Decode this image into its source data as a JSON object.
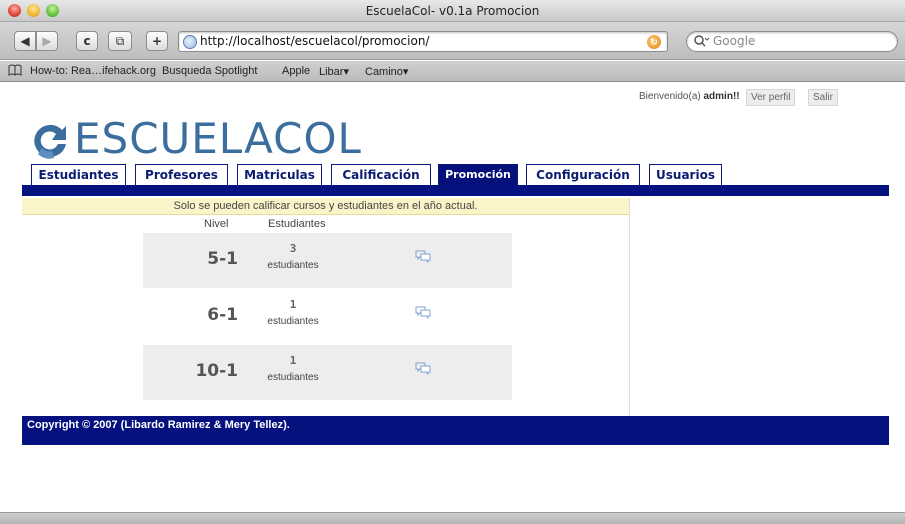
{
  "window": {
    "title": "EscuelaCol- v0.1a Promocion"
  },
  "toolbar": {
    "back": "◀",
    "forward": "▶",
    "reload": "c",
    "snapback": "⧉",
    "add": "+",
    "url": "http://localhost/escuelacol/promocion/",
    "search_placeholder": "Google"
  },
  "bookmarks": [
    "How-to: Rea…ifehack.org",
    "Busqueda Spotlight",
    "Apple",
    "Libar▾",
    "Camino▾"
  ],
  "header": {
    "welcome_prefix": "Bienvenido(a)",
    "username": "admin!!",
    "profile_button": "Ver perfil",
    "logout_button": "Salir",
    "logo_text": "ESCUELACOL"
  },
  "tabs": [
    {
      "label": "Estudiantes",
      "active": false
    },
    {
      "label": "Profesores",
      "active": false
    },
    {
      "label": "Matriculas",
      "active": false
    },
    {
      "label": "Calificación",
      "active": false
    },
    {
      "label": "Promoción",
      "active": true
    },
    {
      "label": "Configuración",
      "active": false
    },
    {
      "label": "Usuarios",
      "active": false
    }
  ],
  "notice": "Solo se pueden calificar cursos y estudiantes en el año actual.",
  "table": {
    "headers": {
      "nivel": "Nivel",
      "estudiantes": "Estudiantes"
    },
    "rows": [
      {
        "nivel": "5-1",
        "count": "3",
        "unit": "estudiantes"
      },
      {
        "nivel": "6-1",
        "count": "1",
        "unit": "estudiantes"
      },
      {
        "nivel": "10-1",
        "count": "1",
        "unit": "estudiantes"
      }
    ]
  },
  "footer": "Copyright © 2007 (Libardo Ramirez & Mery Tellez).",
  "colors": {
    "nav_blue": "#04117f",
    "logo_blue": "#3b6e9f",
    "notice_bg": "#fbf4c9",
    "row_shade": "#ededed"
  }
}
